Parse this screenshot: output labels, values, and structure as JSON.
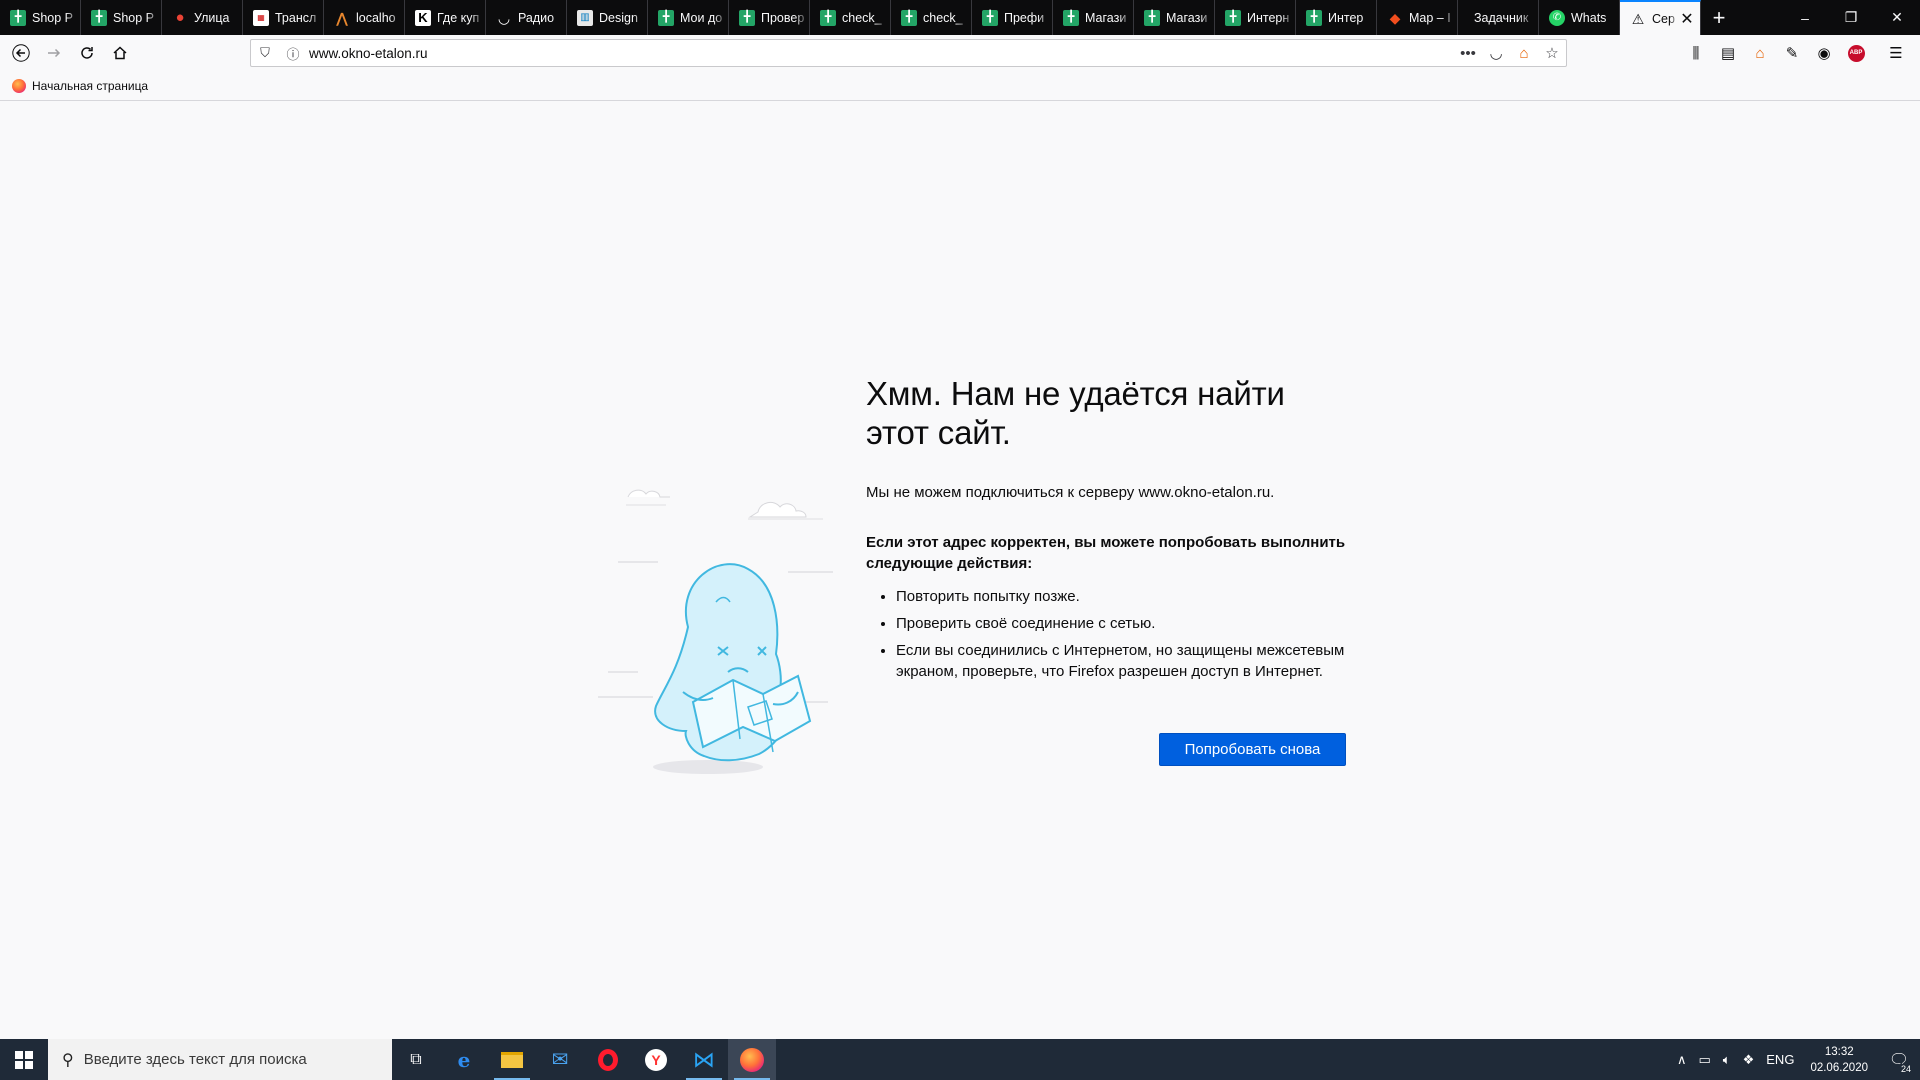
{
  "tabs": [
    {
      "label": "Shop P",
      "icon": "google-sheets-icon",
      "active": false
    },
    {
      "label": "Shop P",
      "icon": "google-sheets-icon",
      "active": false
    },
    {
      "label": "Улица",
      "icon": "map-pin-icon",
      "active": false
    },
    {
      "label": "Трансл",
      "icon": "no-cache-icon",
      "active": false
    },
    {
      "label": "localho",
      "icon": "localhost-icon",
      "active": false
    },
    {
      "label": "Где куп",
      "icon": "k-icon",
      "active": false
    },
    {
      "label": "Радио",
      "icon": "radio-icon",
      "active": false
    },
    {
      "label": "Design",
      "icon": "trello-icon",
      "active": false
    },
    {
      "label": "Мои до",
      "icon": "google-sheets-icon",
      "active": false
    },
    {
      "label": "Провер",
      "icon": "google-sheets-icon",
      "active": false
    },
    {
      "label": "check_",
      "icon": "google-sheets-icon",
      "active": false
    },
    {
      "label": "check_",
      "icon": "google-sheets-icon",
      "active": false
    },
    {
      "label": "Префи",
      "icon": "google-sheets-icon",
      "active": false
    },
    {
      "label": "Магази",
      "icon": "google-sheets-icon",
      "active": false
    },
    {
      "label": "Магази",
      "icon": "google-sheets-icon",
      "active": false
    },
    {
      "label": "Интерн",
      "icon": "google-sheets-icon",
      "active": false
    },
    {
      "label": "Интер",
      "icon": "google-sheets-icon",
      "active": false
    },
    {
      "label": "Map – I",
      "icon": "figma-icon",
      "active": false
    },
    {
      "label": "Задачник",
      "icon": "",
      "active": false
    },
    {
      "label": "Whats",
      "icon": "whatsapp-icon",
      "active": false
    },
    {
      "label": "Сер",
      "icon": "warning-icon",
      "active": true
    }
  ],
  "new_tab_label": "+",
  "window_controls": {
    "minimize": "–",
    "restore": "❐",
    "close": "✕"
  },
  "nav": {
    "url": "www.okno-etalon.ru",
    "url_icons": [
      "shield-icon",
      "info-icon"
    ],
    "page_actions": [
      "more-icon",
      "pocket-icon",
      "home-extension-icon",
      "bookmark-star-icon"
    ],
    "toolbar_icons": [
      "library-icon",
      "sidebar-icon",
      "extension-house-icon",
      "eyedropper-icon",
      "account-icon",
      "adblock-plus-icon",
      "menu-icon"
    ],
    "abp_label": "ABP"
  },
  "bookmarks": [
    {
      "label": "Начальная страница"
    }
  ],
  "error": {
    "title": "Хмм. Нам не удаётся найти этот сайт.",
    "short": "Мы не можем подключиться к серверу www.okno-etalon.ru.",
    "heading": "Если этот адрес корректен, вы можете попробовать выполнить следующие действия:",
    "items": [
      "Повторить попытку позже.",
      "Проверить своё соединение с сетью.",
      "Если вы соединились с Интернетом, но защищены межсетевым экраном, проверьте, что Firefox разрешен доступ в Интернет."
    ],
    "retry_label": "Попробовать снова"
  },
  "taskbar": {
    "search_placeholder": "Введите здесь текст для поиска",
    "apps": [
      "task-view-icon",
      "edge-icon",
      "file-explorer-icon",
      "mail-icon",
      "opera-icon",
      "yandex-browser-icon",
      "vscode-icon",
      "firefox-icon"
    ],
    "tray": {
      "lang": "ENG",
      "time": "13:32",
      "date": "02.06.2020",
      "notifications": "24"
    }
  },
  "colors": {
    "accent": "#0060df",
    "tab_active_border": "#0a84ff",
    "tabbar_bg": "#0c0c0d",
    "taskbar_bg": "#1f2a38",
    "page_bg": "#f9f9fa"
  }
}
